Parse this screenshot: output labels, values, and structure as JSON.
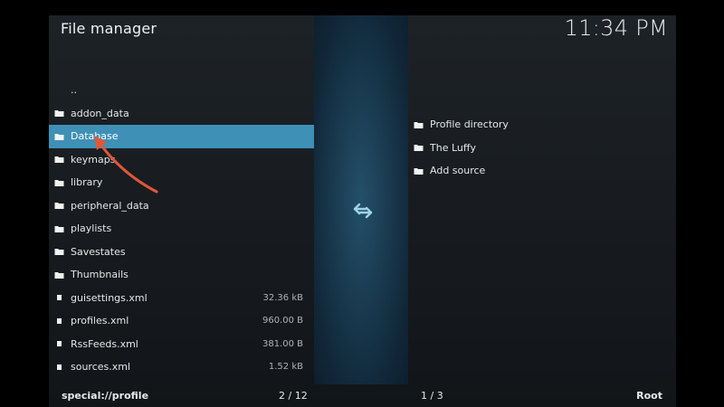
{
  "header": {
    "title": "File manager",
    "clock": "11:34 PM"
  },
  "left_pane": {
    "items": [
      {
        "label": "..",
        "icon": "none",
        "size": ""
      },
      {
        "label": "addon_data",
        "icon": "folder-icon",
        "size": ""
      },
      {
        "label": "Database",
        "icon": "folder-icon",
        "size": "",
        "selected": true
      },
      {
        "label": "keymaps",
        "icon": "folder-icon",
        "size": ""
      },
      {
        "label": "library",
        "icon": "folder-icon",
        "size": ""
      },
      {
        "label": "peripheral_data",
        "icon": "folder-icon",
        "size": ""
      },
      {
        "label": "playlists",
        "icon": "folder-icon",
        "size": ""
      },
      {
        "label": "Savestates",
        "icon": "folder-icon",
        "size": ""
      },
      {
        "label": "Thumbnails",
        "icon": "folder-icon",
        "size": ""
      },
      {
        "label": "guisettings.xml",
        "icon": "file-icon",
        "size": "32.36 kB"
      },
      {
        "label": "profiles.xml",
        "icon": "file-icon",
        "size": "960.00 B"
      },
      {
        "label": "RssFeeds.xml",
        "icon": "file-icon",
        "size": "381.00 B"
      },
      {
        "label": "sources.xml",
        "icon": "file-icon",
        "size": "1.52 kB"
      }
    ],
    "footer_path": "special://profile",
    "footer_count": "2 / 12"
  },
  "right_pane": {
    "items": [
      {
        "label": "Profile directory",
        "icon": "folder-icon"
      },
      {
        "label": "The Luffy",
        "icon": "folder-icon"
      },
      {
        "label": "Add source",
        "icon": "folder-icon"
      }
    ],
    "footer_count": "1 / 3",
    "footer_path": "Root"
  },
  "colors": {
    "selection": "#3f90b6",
    "center_strip": "#1a3b50",
    "annotation_arrow": "#e0573a"
  }
}
